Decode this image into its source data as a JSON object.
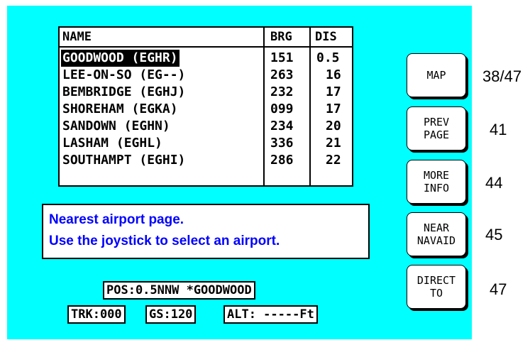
{
  "table": {
    "headers": {
      "name": "NAME",
      "brg": "BRG",
      "dis": "DIS"
    },
    "rows": [
      {
        "name": "GOODWOOD (EGHR)",
        "brg": "151",
        "dis": "0.5"
      },
      {
        "name": "LEE-ON-SO (EG--)",
        "brg": "263",
        "dis": "16"
      },
      {
        "name": "BEMBRIDGE (EGHJ)",
        "brg": "232",
        "dis": "17"
      },
      {
        "name": "SHOREHAM (EGKA)",
        "brg": "099",
        "dis": "17"
      },
      {
        "name": "SANDOWN (EGHN)",
        "brg": "234",
        "dis": "20"
      },
      {
        "name": "LASHAM (EGHL)",
        "brg": "336",
        "dis": "21"
      },
      {
        "name": "SOUTHAMPT (EGHI)",
        "brg": "286",
        "dis": "22"
      }
    ]
  },
  "help": {
    "line1": "Nearest airport page.",
    "line2": "Use the joystick to select an airport."
  },
  "status": {
    "pos": "POS:0.5NNW *GOODWOOD",
    "trk": "TRK:000",
    "gs": "GS:120",
    "alt": "ALT: -----Ft"
  },
  "softkeys": [
    {
      "line1": "MAP",
      "line2": "",
      "page": "38/47"
    },
    {
      "line1": "PREV",
      "line2": "PAGE",
      "page": "41"
    },
    {
      "line1": "MORE",
      "line2": "INFO",
      "page": "44"
    },
    {
      "line1": "NEAR",
      "line2": "NAVAID",
      "page": "45"
    },
    {
      "line1": "DIRECT",
      "line2": "TO",
      "page": "47"
    }
  ],
  "colors": {
    "screen": "#00ffff",
    "help_text": "#0000ff"
  }
}
